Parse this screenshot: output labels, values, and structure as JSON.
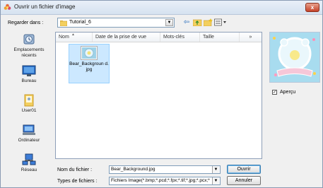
{
  "window": {
    "title": "Ouvrir un fichier d'image",
    "close_label": "x"
  },
  "look_in": {
    "label": "Regarder dans :",
    "path": "Tutorial_6"
  },
  "toolbar": {
    "back_icon": "back-arrow-icon",
    "up_icon": "up-folder-icon",
    "new_folder_icon": "new-folder-icon",
    "views_icon": "view-menu-icon"
  },
  "places": [
    {
      "label": "Emplacements récents",
      "icon": "recent-places-icon"
    },
    {
      "label": "Bureau",
      "icon": "desktop-icon"
    },
    {
      "label": "User01",
      "icon": "user-folder-icon"
    },
    {
      "label": "Ordinateur",
      "icon": "computer-icon"
    },
    {
      "label": "Réseau",
      "icon": "network-icon"
    }
  ],
  "columns": [
    "Nom",
    "Date de la prise de vue",
    "Mots-clés",
    "Taille",
    "»"
  ],
  "files": [
    {
      "name": "Bear_Background.jpg",
      "display": "Bear_Backgroun d.jpg"
    }
  ],
  "preview": {
    "checkbox_label": "Aperçu",
    "checked": true
  },
  "filename": {
    "label": "Nom du fichier :",
    "value": "Bear_Background.jpg"
  },
  "filetype": {
    "label": "Types de fichiers :",
    "value": "Fichiers Image(*.bmp;*.pcd;*.fpx;*.tif;*.jpg;*.pcx;*."
  },
  "buttons": {
    "open": "Ouvrir",
    "cancel": "Annuler"
  },
  "colors": {
    "selection": "#cce8ff",
    "titlebar": "#d6e2f0",
    "close": "#c5432a"
  }
}
